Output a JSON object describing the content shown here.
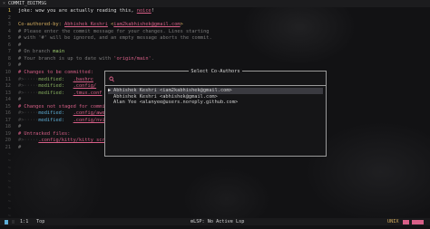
{
  "tab": {
    "close_glyph": "×",
    "title": "COMMIT_EDITMSG"
  },
  "editor": {
    "lines": [
      {
        "num": "1",
        "current": true,
        "parts": [
          {
            "t": "joke: wow you are actually reading this, ",
            "c": "c-white"
          },
          {
            "t": "noice",
            "c": "c-link"
          },
          {
            "t": "!",
            "c": "c-white"
          }
        ]
      },
      {
        "num": "2",
        "parts": []
      },
      {
        "num": "3",
        "parts": [
          {
            "t": "Co-authored-by: ",
            "c": "c-yellow"
          },
          {
            "t": "Abhishek Keshri",
            "c": "c-link"
          },
          {
            "t": " <",
            "c": "c-yellow"
          },
          {
            "t": "iam2kabhishek@gmail.com",
            "c": "c-link"
          },
          {
            "t": ">",
            "c": "c-yellow"
          }
        ]
      },
      {
        "num": "4",
        "parts": [
          {
            "t": "# Please enter the commit message for your changes. Lines starting",
            "c": "c-comment"
          }
        ]
      },
      {
        "num": "5",
        "parts": [
          {
            "t": "# with '#' will be ignored, and an empty message aborts the commit.",
            "c": "c-comment"
          }
        ]
      },
      {
        "num": "6",
        "parts": [
          {
            "t": "#",
            "c": "c-comment"
          }
        ]
      },
      {
        "num": "7",
        "parts": [
          {
            "t": "# On branch ",
            "c": "c-comment"
          },
          {
            "t": "main",
            "c": "c-lgreen"
          }
        ]
      },
      {
        "num": "8",
        "parts": [
          {
            "t": "# Your branch is up to date with ",
            "c": "c-comment"
          },
          {
            "t": "'origin/main'",
            "c": "c-pink"
          },
          {
            "t": ".",
            "c": "c-comment"
          }
        ]
      },
      {
        "num": "9",
        "parts": [
          {
            "t": "#",
            "c": "c-comment"
          }
        ]
      },
      {
        "num": "10",
        "parts": [
          {
            "t": "# Changes to be committed:",
            "c": "c-pink"
          }
        ]
      },
      {
        "num": "11",
        "parts": [
          {
            "t": "#>·····",
            "c": "c-faint"
          },
          {
            "t": "modified:",
            "c": "c-green"
          },
          {
            "t": "   ",
            "c": "c-white"
          },
          {
            "t": ".bashrc",
            "c": "c-link"
          }
        ]
      },
      {
        "num": "12",
        "parts": [
          {
            "t": "#>·····",
            "c": "c-faint"
          },
          {
            "t": "modified:",
            "c": "c-green"
          },
          {
            "t": "   ",
            "c": "c-white"
          },
          {
            "t": ".config/",
            "c": "c-link"
          }
        ]
      },
      {
        "num": "13",
        "parts": [
          {
            "t": "#>·····",
            "c": "c-faint"
          },
          {
            "t": "modified:",
            "c": "c-green"
          },
          {
            "t": "   ",
            "c": "c-white"
          },
          {
            "t": ".tmux.conf",
            "c": "c-link"
          }
        ]
      },
      {
        "num": "14",
        "parts": [
          {
            "t": "#",
            "c": "c-comment"
          }
        ]
      },
      {
        "num": "15",
        "parts": [
          {
            "t": "# Changes not staged for commit:",
            "c": "c-pink"
          }
        ]
      },
      {
        "num": "16",
        "parts": [
          {
            "t": "#>·····",
            "c": "c-faint"
          },
          {
            "t": "modified:",
            "c": "c-blue"
          },
          {
            "t": "   ",
            "c": "c-white"
          },
          {
            "t": ".config/awes",
            "c": "c-link"
          }
        ]
      },
      {
        "num": "17",
        "parts": [
          {
            "t": "#>·····",
            "c": "c-faint"
          },
          {
            "t": "modified:",
            "c": "c-blue"
          },
          {
            "t": "   ",
            "c": "c-white"
          },
          {
            "t": ".config/nvim",
            "c": "c-link"
          }
        ]
      },
      {
        "num": "18",
        "parts": [
          {
            "t": "#",
            "c": "c-comment"
          }
        ]
      },
      {
        "num": "19",
        "parts": [
          {
            "t": "# Untracked files:",
            "c": "c-pink"
          }
        ]
      },
      {
        "num": "20",
        "parts": [
          {
            "t": "#>·····",
            "c": "c-faint"
          },
          {
            "t": ".config/kitty/kitty_scro",
            "c": "c-link"
          }
        ]
      },
      {
        "num": "21",
        "parts": [
          {
            "t": "#",
            "c": "c-comment"
          }
        ]
      }
    ],
    "tildes": 11,
    "tilde_glyph": "~"
  },
  "dialog": {
    "title": "Select Co-Authors",
    "search_placeholder": "",
    "search_value": "",
    "caret_glyph": "▶",
    "results": [
      {
        "label": "Abhishek Keshri <iam2kabhishek@gmail.com>",
        "selected": true
      },
      {
        "label": "Abhishek Keshri <abhishek@gmail.com>",
        "selected": false
      },
      {
        "label": "Alan Yee <alanyee@users.noreply.github.com>",
        "selected": false
      }
    ]
  },
  "status": {
    "position": "1:1",
    "scroll": "Top",
    "lsp": "⚙LSP: No Active Lsp",
    "fileformat": "UNIX"
  },
  "colors": {
    "accent": "#d75f87",
    "mode": "#5fafd7",
    "background": "#121214"
  }
}
